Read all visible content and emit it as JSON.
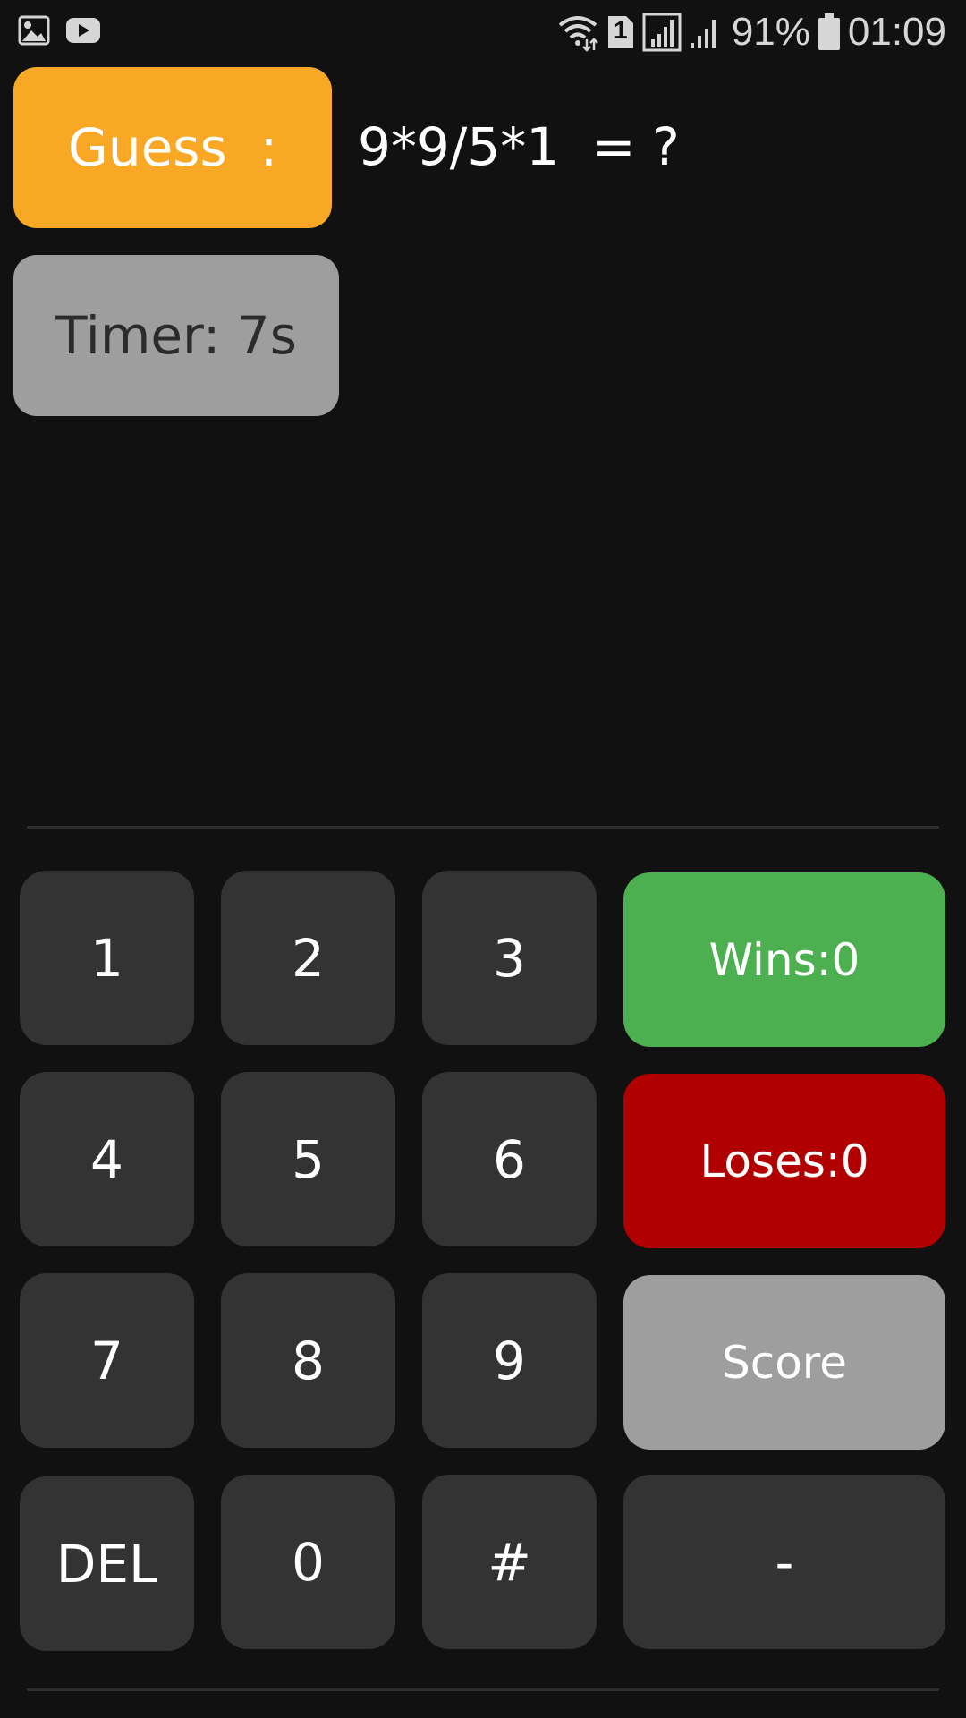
{
  "status_bar": {
    "left_icons": [
      "image-icon",
      "youtube-icon"
    ],
    "sim_slot": "1",
    "battery": "91%",
    "time": "01:09"
  },
  "game": {
    "guess_label": "Guess  :",
    "equation": "9*9/5*1  = ?",
    "timer": "Timer: 7s"
  },
  "keypad": {
    "keys": [
      "1",
      "2",
      "3",
      "4",
      "5",
      "6",
      "7",
      "8",
      "9",
      "DEL",
      "0",
      "#"
    ],
    "wins": "Wins:0",
    "loses": "Loses:0",
    "score": "Score",
    "minus": "-"
  },
  "colors": {
    "background": "#111111",
    "guess": "#f9a825",
    "timer": "#9e9e9e",
    "key": "#333333",
    "wins": "#4caf50",
    "loses": "#b00000",
    "score": "#9e9e9e"
  }
}
